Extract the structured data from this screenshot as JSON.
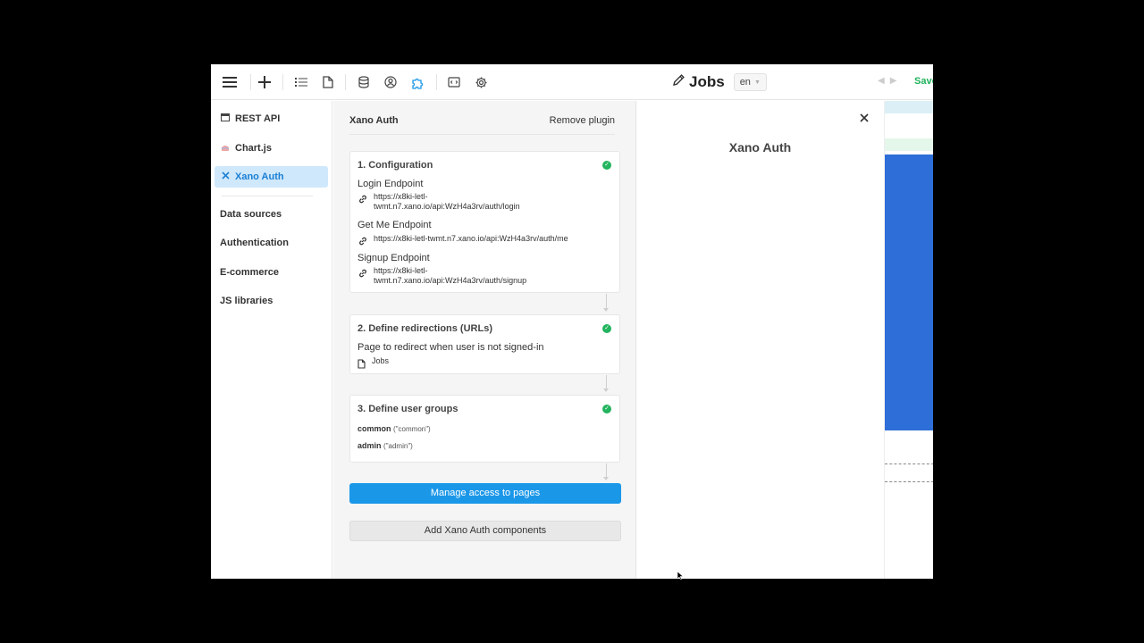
{
  "topbar": {
    "page_title": "Jobs",
    "language": "en",
    "save_label": "Save"
  },
  "sidebar": {
    "items": [
      {
        "label": "REST API",
        "icon": "rest-api-icon"
      },
      {
        "label": "Chart.js",
        "icon": "chartjs-icon"
      },
      {
        "label": "Xano Auth",
        "icon": "xano-icon",
        "active": true
      }
    ],
    "links": [
      "Data sources",
      "Authentication",
      "E-commerce",
      "JS libraries"
    ]
  },
  "panel": {
    "title": "Xano Auth",
    "remove_label": "Remove plugin",
    "config": {
      "title": "1. Configuration",
      "login_label": "Login Endpoint",
      "login_url": "https://x8ki-letl-twmt.n7.xano.io/api:WzH4a3rv/auth/login",
      "getme_label": "Get Me Endpoint",
      "getme_url": "https://x8ki-letl-twmt.n7.xano.io/api:WzH4a3rv/auth/me",
      "signup_label": "Signup Endpoint",
      "signup_url": "https://x8ki-letl-twmt.n7.xano.io/api:WzH4a3rv/auth/signup"
    },
    "redirect": {
      "title": "2. Define redirections (URLs)",
      "label": "Page to redirect when user is not signed-in",
      "page": "Jobs"
    },
    "groups": {
      "title": "3. Define user groups",
      "items": [
        {
          "name": "common",
          "id": "(\"common\")"
        },
        {
          "name": "admin",
          "id": "(\"admin\")"
        }
      ]
    },
    "manage_label": "Manage access to pages",
    "add_label": "Add Xano Auth components"
  },
  "detail": {
    "title": "Xano Auth"
  },
  "colors": {
    "accent": "#1b97e8",
    "success": "#22b45e",
    "save": "#1fb25a",
    "preview_blue": "#2d6ed8"
  }
}
